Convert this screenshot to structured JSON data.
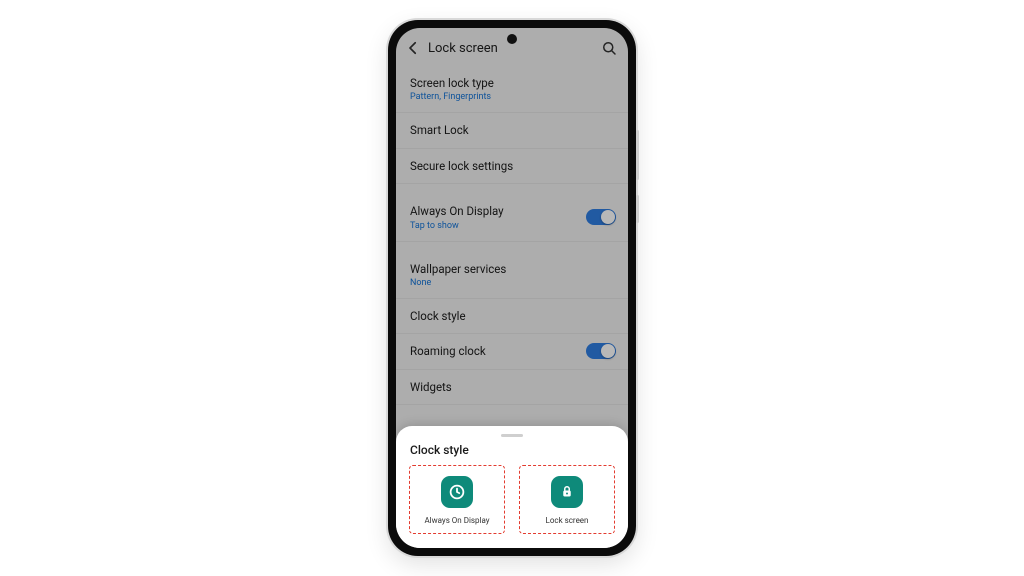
{
  "header": {
    "title": "Lock screen"
  },
  "rows": {
    "lockType": {
      "title": "Screen lock type",
      "sub": "Pattern, Fingerprints"
    },
    "smartLock": {
      "title": "Smart Lock"
    },
    "secureLock": {
      "title": "Secure lock settings"
    },
    "aod": {
      "title": "Always On Display",
      "sub": "Tap to show"
    },
    "wallpaper": {
      "title": "Wallpaper services",
      "sub": "None"
    },
    "clockStyle": {
      "title": "Clock style"
    },
    "roaming": {
      "title": "Roaming clock"
    },
    "widgets": {
      "title": "Widgets"
    }
  },
  "sheet": {
    "title": "Clock style",
    "optionA": "Always On Display",
    "optionB": "Lock screen"
  }
}
